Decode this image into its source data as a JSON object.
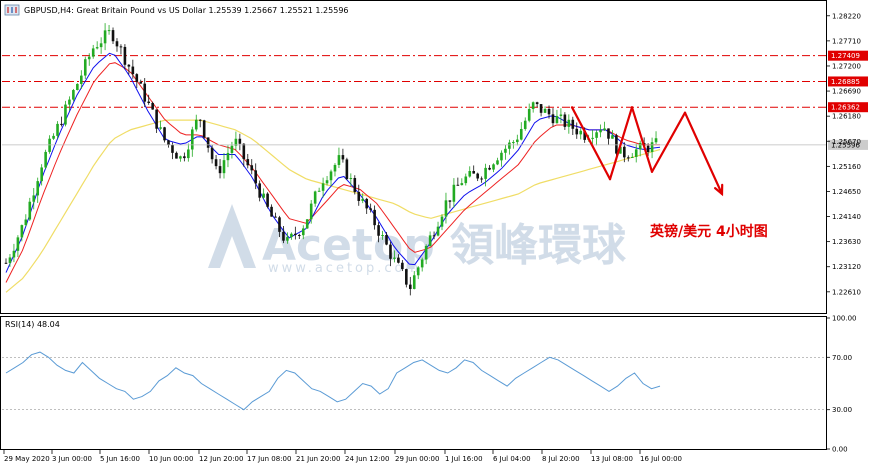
{
  "window": {
    "header": "GBPUSD,H4:  Great Britain Pound vs US Dollar  1.25539 1.25667 1.25521 1.25596",
    "rsi_label": "RSI(14) 48.04"
  },
  "watermark": {
    "main": "Acetop 領峰環球",
    "sub": "www.acetop.com"
  },
  "annotation": "英镑/美元 4小时图",
  "colors": {
    "up": "#22aa22",
    "down": "#111111",
    "fast_ma": "#1010ee",
    "mid_ma": "#ee2222",
    "slow_ma": "#f0dd66",
    "level": "#e00000",
    "rsi": "#5b9bd5",
    "arrow": "#e00000"
  },
  "chart_data": [
    {
      "type": "candlestick",
      "symbol": "GBPUSD",
      "timeframe": "H4",
      "ylim": [
        1.222,
        1.285
      ],
      "y_ticks": [
        "1.28220",
        "1.27710",
        "1.27200",
        "1.26690",
        "1.26180",
        "1.25670",
        "1.25160",
        "1.24650",
        "1.24140",
        "1.23630",
        "1.23120",
        "1.22610"
      ],
      "x_ticks": [
        "29 May 2020",
        "3 Jun 00:00",
        "5 Jun 16:00",
        "10 Jun 00:00",
        "12 Jun 20:00",
        "17 Jun 08:00",
        "21 Jun 20:00",
        "24 Jun 12:00",
        "29 Jun 00:00",
        "1 Jul 16:00",
        "6 Jul 04:00",
        "8 Jul 20:00",
        "13 Jul 08:00",
        "16 Jul 00:00"
      ],
      "current_price": "1.25596",
      "levels": [
        {
          "value": 1.27409,
          "label": "1.27409"
        },
        {
          "value": 1.26885,
          "label": "1.26885"
        },
        {
          "value": 1.26362,
          "label": "1.26362"
        }
      ],
      "close_path": [
        1.232,
        1.24,
        1.252,
        1.26,
        1.268,
        1.276,
        1.279,
        1.272,
        1.265,
        1.257,
        1.253,
        1.262,
        1.25,
        1.257,
        1.25,
        1.242,
        1.236,
        1.24,
        1.249,
        1.253,
        1.246,
        1.24,
        1.233,
        1.227,
        1.236,
        1.244,
        1.249,
        1.25,
        1.254,
        1.257,
        1.264,
        1.262,
        1.26,
        1.258,
        1.26,
        1.254,
        1.255,
        1.256
      ],
      "ma_fast_path": [
        1.23,
        1.238,
        1.249,
        1.258,
        1.266,
        1.272,
        1.275,
        1.27,
        1.263,
        1.257,
        1.256,
        1.258,
        1.254,
        1.254,
        1.249,
        1.242,
        1.237,
        1.239,
        1.246,
        1.25,
        1.246,
        1.241,
        1.235,
        1.231,
        1.236,
        1.242,
        1.246,
        1.248,
        1.251,
        1.255,
        1.261,
        1.262,
        1.26,
        1.259,
        1.259,
        1.256,
        1.255,
        1.2555
      ],
      "ma_mid_path": [
        1.228,
        1.235,
        1.245,
        1.254,
        1.262,
        1.269,
        1.273,
        1.271,
        1.266,
        1.261,
        1.258,
        1.258,
        1.256,
        1.255,
        1.251,
        1.246,
        1.241,
        1.24,
        1.244,
        1.248,
        1.247,
        1.244,
        1.239,
        1.234,
        1.235,
        1.239,
        1.243,
        1.246,
        1.249,
        1.252,
        1.257,
        1.26,
        1.26,
        1.259,
        1.259,
        1.257,
        1.256,
        1.256
      ],
      "ma_slow_path": [
        1.226,
        1.229,
        1.234,
        1.24,
        1.246,
        1.252,
        1.257,
        1.259,
        1.26,
        1.261,
        1.261,
        1.261,
        1.26,
        1.259,
        1.257,
        1.254,
        1.251,
        1.249,
        1.248,
        1.247,
        1.246,
        1.245,
        1.244,
        1.242,
        1.241,
        1.242,
        1.243,
        1.244,
        1.245,
        1.246,
        1.248,
        1.249,
        1.25,
        1.251,
        1.252,
        1.253,
        1.254,
        1.255
      ],
      "forecast_arrow": [
        [
          1.2636,
          1.249
        ],
        [
          1.249,
          1.2636
        ],
        [
          1.2636,
          1.2505
        ],
        [
          1.2505,
          1.2625
        ],
        [
          1.2625,
          1.246
        ]
      ]
    },
    {
      "type": "line",
      "name": "RSI(14)",
      "ylim": [
        0,
        100
      ],
      "y_ticks": [
        "100.00",
        "70.00",
        "30.00",
        "0.00"
      ],
      "levels": [
        70,
        30
      ],
      "values": [
        58,
        62,
        66,
        72,
        74,
        70,
        64,
        60,
        58,
        66,
        60,
        54,
        50,
        46,
        44,
        38,
        40,
        44,
        52,
        56,
        62,
        58,
        56,
        50,
        46,
        42,
        38,
        34,
        30,
        36,
        40,
        44,
        54,
        60,
        58,
        52,
        46,
        44,
        40,
        36,
        38,
        44,
        50,
        48,
        42,
        46,
        58,
        62,
        66,
        68,
        64,
        60,
        58,
        62,
        68,
        66,
        60,
        56,
        52,
        48,
        54,
        58,
        62,
        66,
        70,
        68,
        64,
        60,
        56,
        52,
        48,
        44,
        48,
        54,
        58,
        50,
        46,
        48
      ]
    }
  ]
}
